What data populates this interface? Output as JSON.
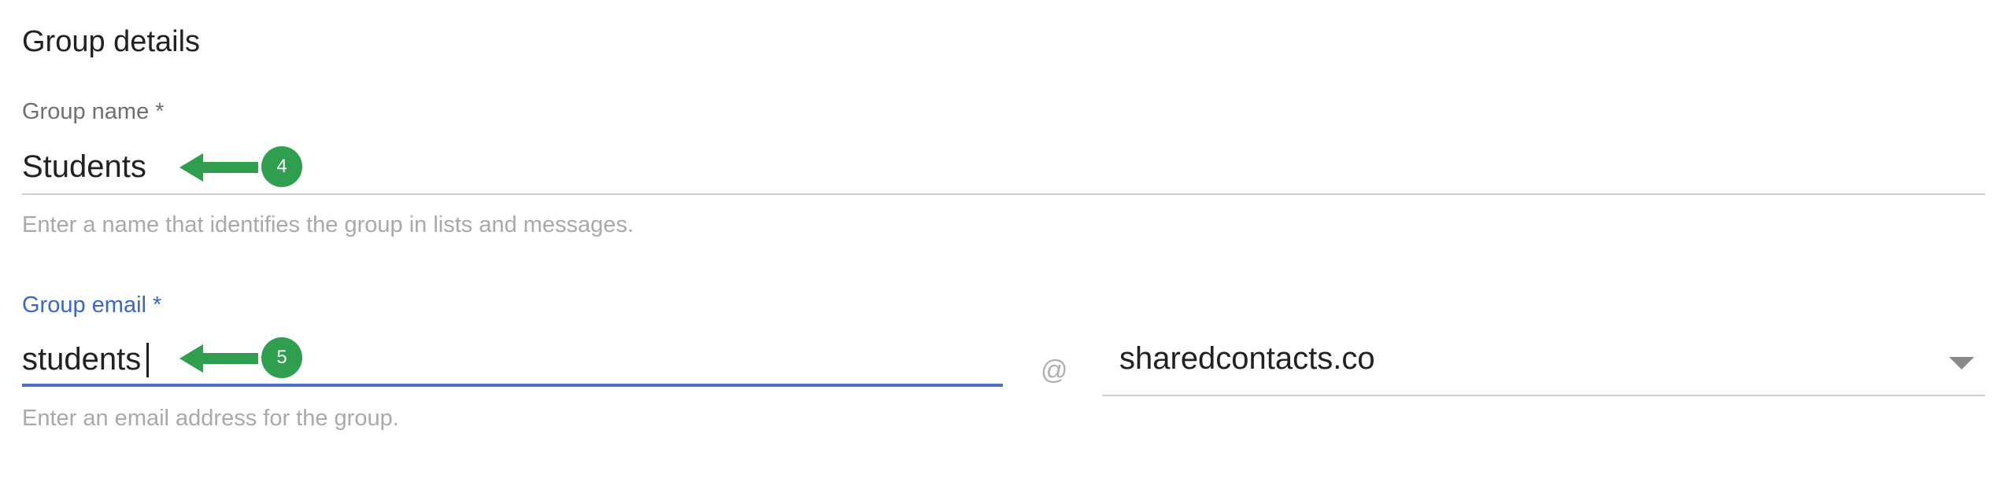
{
  "section": {
    "title": "Group details"
  },
  "group_name": {
    "label": "Group name *",
    "value": "Students",
    "helper": "Enter a name that identifies the group in lists and messages.",
    "annotation_number": "4"
  },
  "group_email": {
    "label": "Group email *",
    "value": "students",
    "helper": "Enter an email address for the group.",
    "annotation_number": "5",
    "at_symbol": "@",
    "domain": "sharedcontacts.co"
  },
  "colors": {
    "accent_blue": "#4a72c4",
    "label_blue": "#3b67c1",
    "annotation_green": "#2f9e4f"
  },
  "icons": {
    "annotation_arrow": "arrow-left-icon",
    "dropdown": "chevron-down-icon"
  }
}
